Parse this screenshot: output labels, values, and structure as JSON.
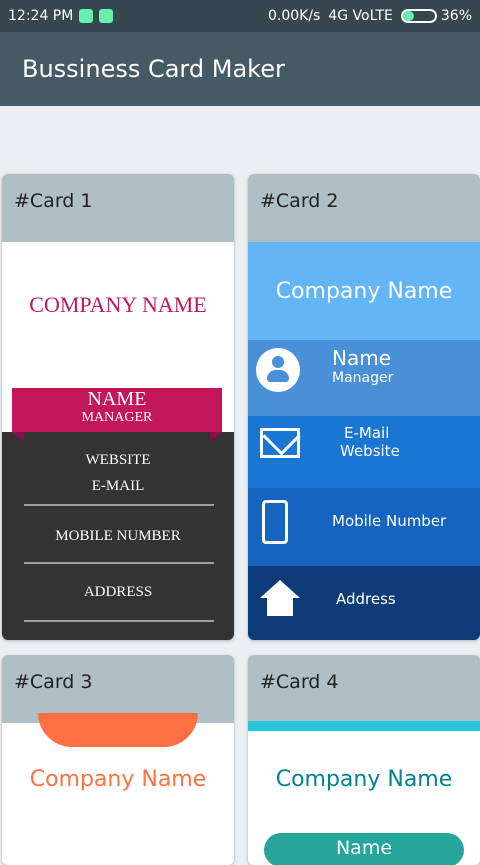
{
  "status_bar": {
    "time": "12:24 PM",
    "network_speed": "0.00K/s",
    "network": "4G VoLTE",
    "battery": "36%"
  },
  "app": {
    "title": "Bussiness Card Maker"
  },
  "cards": [
    {
      "label": "#Card 1",
      "company": "COMPANY NAME",
      "name": "NAME",
      "title": "MANAGER",
      "website": "WEBSITE",
      "email": "E-MAIL",
      "mobile": "MOBILE NUMBER",
      "address": "ADDRESS"
    },
    {
      "label": "#Card 2",
      "company": "Company Name",
      "name": "Name",
      "title": "Manager",
      "email": "E-Mail",
      "website": "Website",
      "mobile": "Mobile Number",
      "address": "Address"
    },
    {
      "label": "#Card 3",
      "company": "Company Name"
    },
    {
      "label": "#Card 4",
      "company": "Company Name",
      "name": "Name"
    }
  ]
}
